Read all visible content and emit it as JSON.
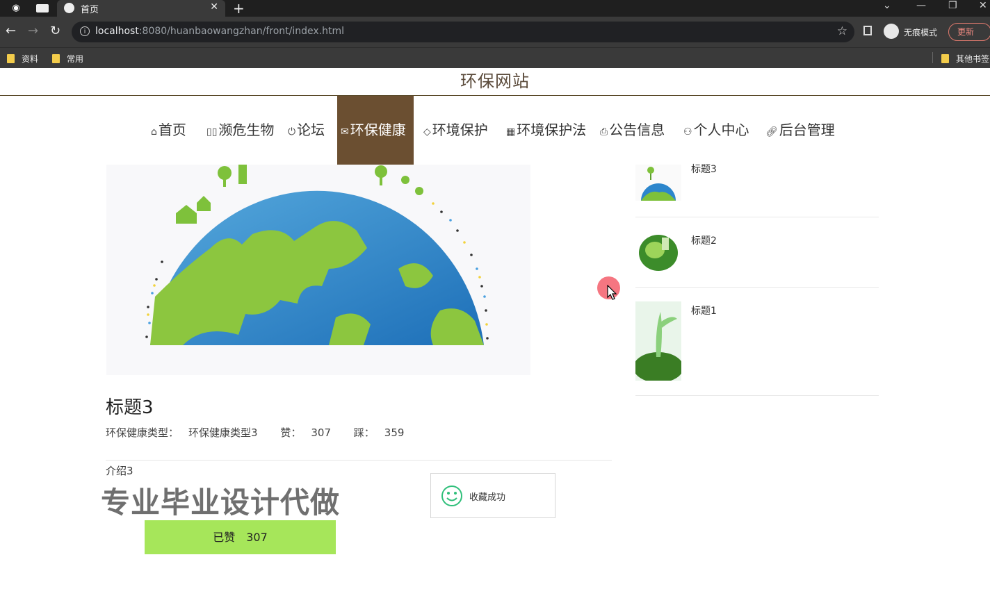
{
  "browser": {
    "tab_title": "首页",
    "new_tab": "+",
    "url_host": "localhost",
    "url_rest": ":8080/huanbaowangzhan/front/index.html",
    "incognito_label": "无痕模式",
    "update_label": "更新",
    "bookmarks": [
      "资料",
      "常用"
    ],
    "other_bookmarks": "其他书签"
  },
  "site": {
    "title": "环保网站"
  },
  "nav": [
    {
      "label": "首页",
      "icon": "home-icon"
    },
    {
      "label": "濒危生物",
      "icon": "book-icon"
    },
    {
      "label": "论坛",
      "icon": "power-icon"
    },
    {
      "label": "环保健康",
      "icon": "mail-icon",
      "active": true
    },
    {
      "label": "环境保护",
      "icon": "tag-icon"
    },
    {
      "label": "环境保护法",
      "icon": "grid-icon"
    },
    {
      "label": "公告信息",
      "icon": "print-icon"
    },
    {
      "label": "个人中心",
      "icon": "user-icon"
    },
    {
      "label": "后台管理",
      "icon": "link-icon"
    }
  ],
  "detail": {
    "title": "标题3",
    "type_label": "环保健康类型：",
    "type_value": "环保健康类型3",
    "like_label": "赞：",
    "like_value": "307",
    "dislike_label": "踩：",
    "dislike_value": "359",
    "intro": "介绍3",
    "liked_button": "已赞　307"
  },
  "overlay": {
    "watermark": "专业毕业设计代做"
  },
  "toast": {
    "message": "收藏成功",
    "icon": "smile-icon",
    "color": "#2fbf7a"
  },
  "sidebar": [
    {
      "title": "标题3"
    },
    {
      "title": "标题2"
    },
    {
      "title": "标题1"
    }
  ],
  "colors": {
    "nav_active": "#6b4f31",
    "liked_button": "#a6e65a",
    "cursor_highlight": "#f46f7a"
  }
}
